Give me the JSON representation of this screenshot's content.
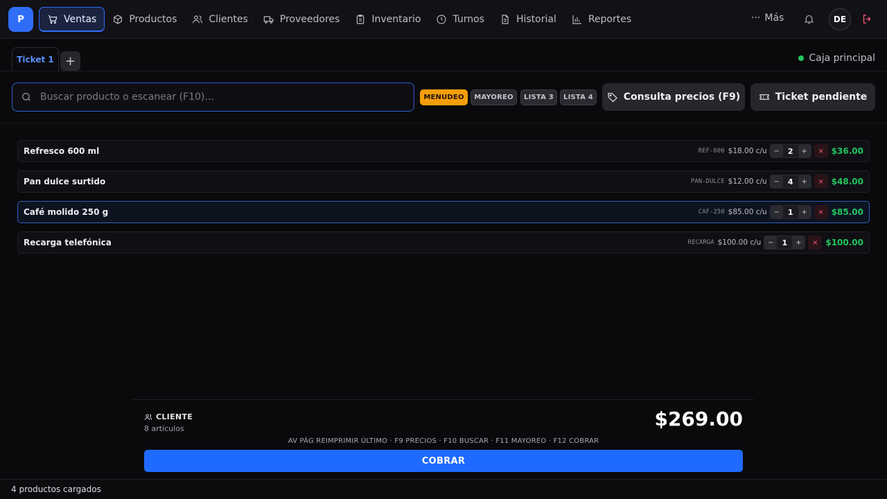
{
  "app": {
    "logo_letter": "P",
    "accent": "#2f6df6"
  },
  "nav": {
    "items": [
      {
        "label": "Ventas",
        "icon": "cart-icon",
        "active": true
      },
      {
        "label": "Productos",
        "icon": "box-icon"
      },
      {
        "label": "Clientes",
        "icon": "users-icon"
      },
      {
        "label": "Proveedores",
        "icon": "truck-icon"
      },
      {
        "label": "Inventario",
        "icon": "clipboard-icon"
      },
      {
        "label": "Turnos",
        "icon": "clock-icon"
      },
      {
        "label": "Historial",
        "icon": "document-icon"
      },
      {
        "label": "Reportes",
        "icon": "bar-chart-icon"
      }
    ],
    "more_label": "Más",
    "avatar_initials": "DE"
  },
  "tabs": {
    "ticket_label": "Ticket 1",
    "add_label": "+"
  },
  "register": {
    "label": "Caja principal",
    "status_color": "#22c55e"
  },
  "search": {
    "placeholder": "Buscar producto o escanear (F10)...",
    "value": ""
  },
  "price_lists": [
    {
      "label": "MENUDEO",
      "active": true
    },
    {
      "label": "MAYOREO"
    },
    {
      "label": "LISTA 3"
    },
    {
      "label": "LISTA 4"
    }
  ],
  "actions": {
    "consulta_label": "Consulta precios (F9)",
    "pendiente_label": "Ticket pendiente"
  },
  "items": [
    {
      "name": "Refresco 600 ml",
      "code": "REF-600",
      "unit_price": "$18.00 c/u",
      "qty": "2",
      "total": "$36.00"
    },
    {
      "name": "Pan dulce surtido",
      "code": "PAN-DULCE",
      "unit_price": "$12.00 c/u",
      "qty": "4",
      "total": "$48.00"
    },
    {
      "name": "Café molido 250 g",
      "code": "CAF-250",
      "unit_price": "$85.00 c/u",
      "qty": "1",
      "total": "$85.00",
      "selected": true
    },
    {
      "name": "Recarga telefónica",
      "code": "RECARGA",
      "unit_price": "$100.00 c/u",
      "qty": "1",
      "total": "$100.00"
    }
  ],
  "stepper": {
    "minus": "−",
    "plus": "+",
    "remove": "×"
  },
  "summary": {
    "cliente_label": "CLIENTE",
    "articulos": "8 artículos",
    "total": "$269.00",
    "shortcuts": "AV PÁG REIMPRIMIR ÚLTIMO · F9 PRECIOS · F10 BUSCAR · F11 MAYOREO · F12 COBRAR",
    "cobrar_label": "COBRAR"
  },
  "status": {
    "text": "4 productos cargados"
  }
}
